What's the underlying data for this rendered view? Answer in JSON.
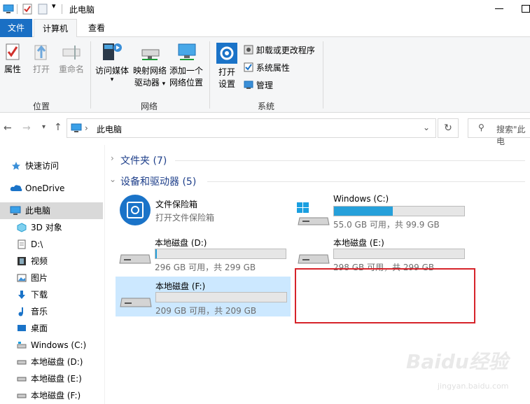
{
  "window": {
    "title": "此电脑",
    "controls": [
      "minimize-icon",
      "maximize-icon"
    ]
  },
  "tabs": [
    "文件",
    "计算机",
    "查看"
  ],
  "ribbon": {
    "location_group": {
      "label": "位置",
      "buttons": [
        "属性",
        "打开",
        "重命名"
      ]
    },
    "network_group": {
      "label": "网络",
      "access_media": "访问媒体",
      "map_drive_line1": "映射网络",
      "map_drive_line2": "驱动器",
      "add_location_line1": "添加一个",
      "add_location_line2": "网络位置"
    },
    "system_group": {
      "label": "系统",
      "open_settings_line1": "打开",
      "open_settings_line2": "设置",
      "uninstall": "卸载或更改程序",
      "system_properties": "系统属性",
      "manage": "管理"
    }
  },
  "address": {
    "path": "此电脑",
    "search_placeholder": "搜索\"此电"
  },
  "nav": {
    "items": [
      {
        "label": "快速访问",
        "icon": "star-icon"
      },
      {
        "label": "OneDrive",
        "icon": "cloud-icon"
      },
      {
        "label": "此电脑",
        "icon": "computer-icon"
      },
      {
        "label": "3D 对象",
        "icon": "cube-icon"
      },
      {
        "label": "D:\\",
        "icon": "document-icon"
      },
      {
        "label": "视频",
        "icon": "video-icon"
      },
      {
        "label": "图片",
        "icon": "picture-icon"
      },
      {
        "label": "下载",
        "icon": "download-icon"
      },
      {
        "label": "音乐",
        "icon": "music-icon"
      },
      {
        "label": "桌面",
        "icon": "desktop-icon"
      },
      {
        "label": "Windows (C:)",
        "icon": "drive-icon"
      },
      {
        "label": "本地磁盘 (D:)",
        "icon": "drive-icon"
      },
      {
        "label": "本地磁盘 (E:)",
        "icon": "drive-icon"
      },
      {
        "label": "本地磁盘 (F:)",
        "icon": "drive-icon"
      }
    ]
  },
  "content": {
    "folders_header": "文件夹 (7)",
    "devices_header": "设备和驱动器 (5)",
    "vault": {
      "name": "文件保险箱",
      "sub": "打开文件保险箱"
    },
    "drives": [
      {
        "name": "Windows (C:)",
        "info": "55.0 GB 可用，共 99.9 GB",
        "used_fraction": 0.45
      },
      {
        "name": "本地磁盘 (D:)",
        "info": "296 GB 可用，共 299 GB",
        "used_fraction": 0.01
      },
      {
        "name": "本地磁盘 (E:)",
        "info": "298 GB 可用，共 299 GB",
        "used_fraction": 0.0
      },
      {
        "name": "本地磁盘 (F:)",
        "info": "209 GB 可用，共 209 GB",
        "used_fraction": 0.0
      }
    ]
  },
  "watermark": {
    "brand": "Baidu经验",
    "url": "jingyan.baidu.com"
  },
  "colors": {
    "accent": "#1a6fc4",
    "bar_fill": "#26a0da",
    "selection": "#cce8ff",
    "highlight_box": "#d6232a"
  }
}
